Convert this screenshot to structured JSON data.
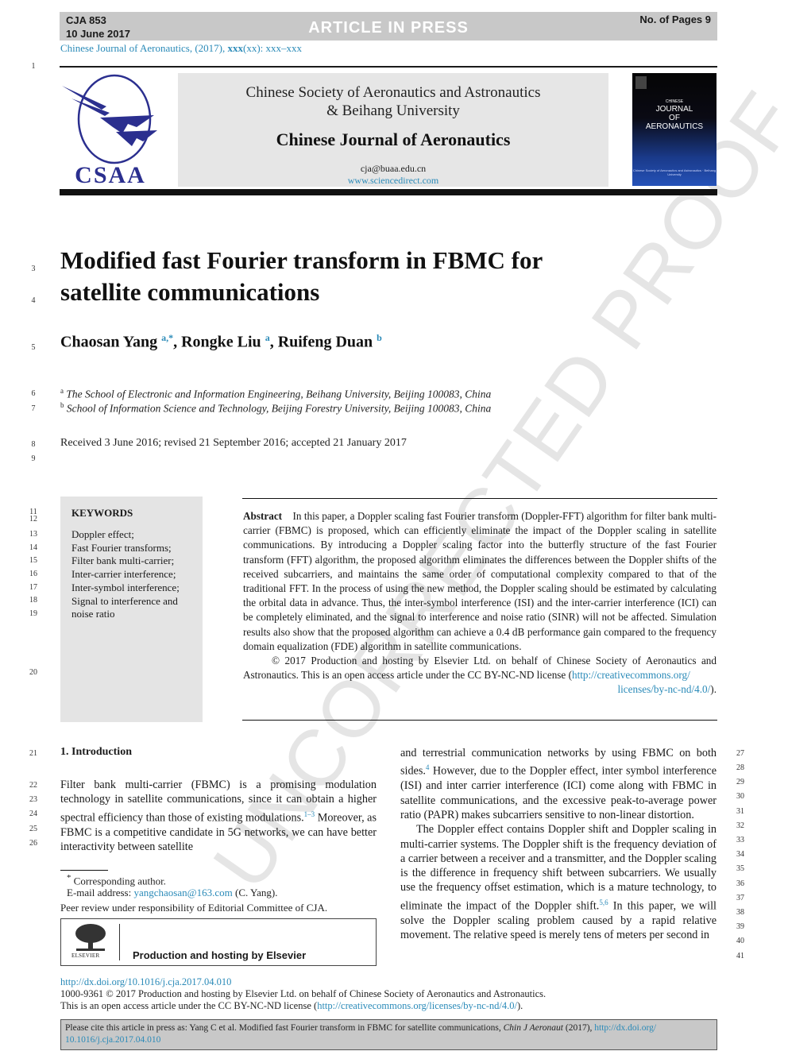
{
  "banner": {
    "article_id": "CJA 853",
    "date": "10 June 2017",
    "status": "ARTICLE IN PRESS",
    "pages": "No. of Pages 9"
  },
  "journal_ref": {
    "prefix": "Chinese Journal of Aeronautics, (2017), ",
    "volume": "xxx",
    "suffix": "(xx): xxx–xxx"
  },
  "masthead": {
    "logo_text": "CSAA",
    "society_line1": "Chinese Society of Aeronautics and Astronautics",
    "society_line2": "& Beihang University",
    "journal_name": "Chinese Journal of Aeronautics",
    "email": "cja@buaa.edu.cn",
    "website": "www.sciencedirect.com",
    "cover": {
      "small": "CHINESE",
      "line1": "JOURNAL",
      "line2": "OF",
      "line3": "AERONAUTICS",
      "sub": "Chinese Society of Aeronautics and Astronautics · Beihang University"
    }
  },
  "article": {
    "title_line1": "Modified fast Fourier transform in FBMC for",
    "title_line2": "satellite communications",
    "authors": [
      {
        "name": "Chaosan Yang",
        "sup": "a,*"
      },
      {
        "name": "Rongke Liu",
        "sup": "a"
      },
      {
        "name": "Ruifeng Duan",
        "sup": "b"
      }
    ],
    "affiliations": [
      {
        "mark": "a",
        "text": "The School of Electronic and Information Engineering, Beihang University, Beijing 100083, China"
      },
      {
        "mark": "b",
        "text": "School of Information Science and Technology, Beijing Forestry University, Beijing 100083, China"
      }
    ],
    "received": "Received 3 June 2016; revised 21 September 2016; accepted 21 January 2017"
  },
  "keywords": {
    "heading": "KEYWORDS",
    "lines": [
      "Doppler effect;",
      "Fast Fourier transforms;",
      "Filter bank multi-carrier;",
      "Inter-carrier interference;",
      "Inter-symbol interference;",
      "Signal to interference and",
      "noise ratio"
    ]
  },
  "abstract": {
    "label": "Abstract",
    "text": "In this paper, a Doppler scaling fast Fourier transform (Doppler-FFT) algorithm for filter bank multi-carrier (FBMC) is proposed, which can efficiently eliminate the impact of the Doppler scaling in satellite communications. By introducing a Doppler scaling factor into the butterfly structure of the fast Fourier transform (FFT) algorithm, the proposed algorithm eliminates the differences between the Doppler shifts of the received subcarriers, and maintains the same order of computational complexity compared to that of the traditional FFT. In the process of using the new method, the Doppler scaling should be estimated by calculating the orbital data in advance. Thus, the inter-symbol interference (ISI) and the inter-carrier interference (ICI) can be completely eliminated, and the signal to interference and noise ratio (SINR) will not be affected. Simulation results also show that the proposed algorithm can achieve a 0.4 dB performance gain compared to the frequency domain equalization (FDE) algorithm in satellite communications.",
    "copyright": "© 2017 Production and hosting by Elsevier Ltd. on behalf of Chinese Society of Aeronautics and Astronautics. This is an open access article under the CC BY-NC-ND license (",
    "license_url_1": "http://creativecommons.org/",
    "license_url_2": "licenses/by-nc-nd/4.0/",
    "copyright_end": ")."
  },
  "intro": {
    "heading": "1. Introduction",
    "col1_a": "Filter bank multi-carrier (FBMC) is a promising modulation technology in satellite communications, since it can obtain a higher spectral efficiency than those of existing modulations.",
    "col1_ref1": "1–3",
    "col1_b": " Moreover, as FBMC is a competitive candidate in 5G networks, we can have better interactivity between satellite",
    "col2_a": "and terrestrial communication networks by using FBMC on both sides.",
    "col2_ref1": "4",
    "col2_b": " However, due to the Doppler effect, inter symbol interference (ISI) and inter carrier interference (ICI) come along with FBMC in satellite communications, and the excessive peak-to-average power ratio (PAPR) makes subcarriers sensitive to non-linear distortion.",
    "col2_p2a": "The Doppler effect contains Doppler shift and Doppler scaling in multi-carrier systems. The Doppler shift is the frequency deviation of a carrier between a receiver and a transmitter, and the Doppler scaling is the difference in frequency shift between subcarriers. We usually use the frequency offset estimation, which is a mature technology, to eliminate the impact of the Doppler shift.",
    "col2_ref2": "5,6",
    "col2_p2b": " In this paper, we will solve the Doppler scaling problem caused by a rapid relative movement. The relative speed is merely tens of meters per second in"
  },
  "footnotes": {
    "corresponding": "Corresponding author.",
    "email_label": "E-mail address: ",
    "email": "yangchaosan@163.com",
    "email_suffix": " (C. Yang).",
    "peer_review": "Peer review under responsibility of Editorial Committee of CJA.",
    "elsevier_label": "ELSEVIER",
    "production": "Production and hosting by Elsevier"
  },
  "footer": {
    "doi": "http://dx.doi.org/10.1016/j.cja.2017.04.010",
    "issn": "1000-9361 © 2017 Production and hosting by Elsevier Ltd. on behalf of Chinese Society of Aeronautics and Astronautics.",
    "oa_prefix": "This is an open access article under the CC BY-NC-ND license (",
    "oa_url": "http://creativecommons.org/licenses/by-nc-nd/4.0/",
    "oa_suffix": ").",
    "cite_prefix": "Please cite this article in press as: Yang C et al. Modified fast Fourier transform in FBMC for satellite communications, ",
    "cite_journal": "Chin J Aeronaut",
    "cite_year": " (2017), ",
    "cite_url_1": "http://dx.doi.org/",
    "cite_url_2": "10.1016/j.cja.2017.04.010"
  },
  "line_numbers": {
    "l1": "1",
    "l3": "3",
    "l4": "4",
    "l5": "5",
    "l6": "6",
    "l7": "7",
    "l8": "8",
    "l9": "9",
    "l11": "11",
    "l12": "12",
    "l13": "13",
    "l14": "14",
    "l15": "15",
    "l16": "16",
    "l17": "17",
    "l18": "18",
    "l19": "19",
    "l20": "20",
    "l21": "21",
    "l22": "22",
    "l23": "23",
    "l24": "24",
    "l25": "25",
    "l26": "26",
    "l27": "27",
    "l28": "28",
    "l29": "29",
    "l30": "30",
    "l31": "31",
    "l32": "32",
    "l33": "33",
    "l34": "34",
    "l35": "35",
    "l36": "36",
    "l37": "37",
    "l38": "38",
    "l39": "39",
    "l40": "40",
    "l41": "41"
  },
  "watermark": "UNCORRECTED PROOF"
}
